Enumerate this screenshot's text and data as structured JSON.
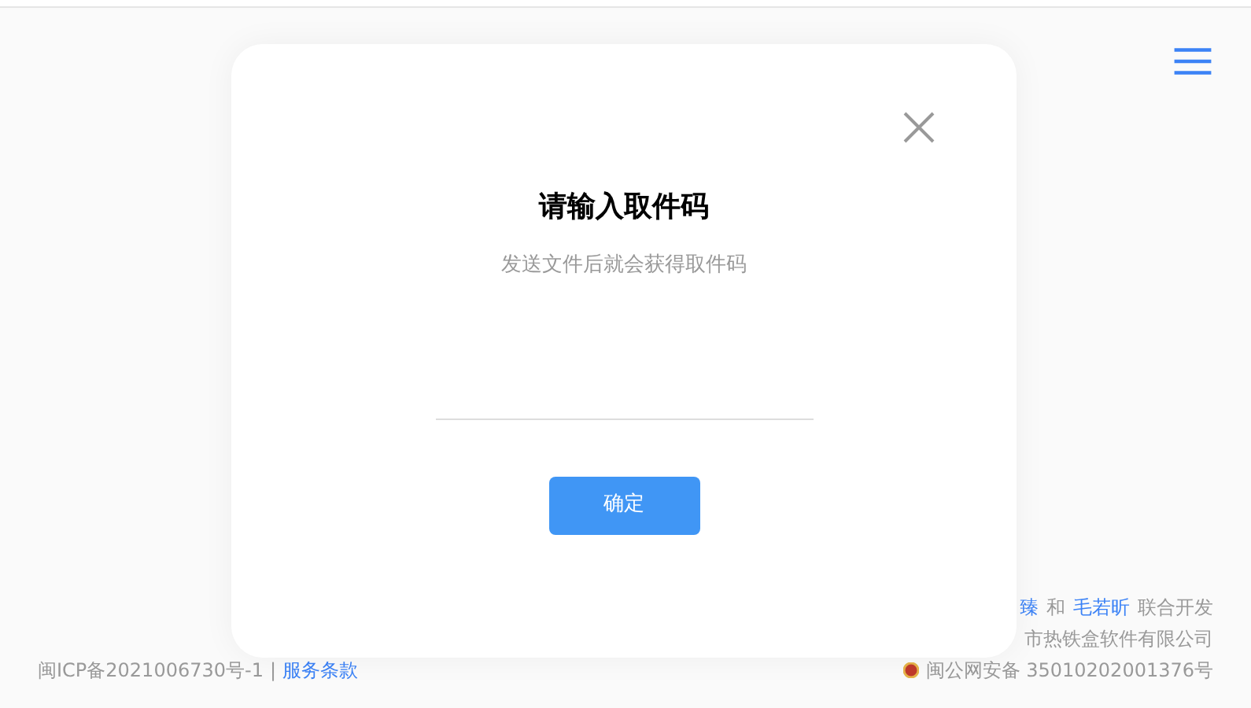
{
  "dialog": {
    "title": "请输入取件码",
    "subtitle": "发送文件后就会获得取件码",
    "button": "确定"
  },
  "footer": {
    "credits": [
      {
        "text": "臻",
        "link": true
      },
      {
        "text": "和",
        "link": false
      },
      {
        "text": "毛若昕",
        "link": true
      },
      {
        "text": "联合开发",
        "link": false
      }
    ],
    "company": "市热铁盒软件有限公司",
    "icp": "闽ICP备2021006730号-1",
    "separator": "|",
    "terms": "服务条款",
    "police": "闽公网安备 35010202001376号"
  }
}
